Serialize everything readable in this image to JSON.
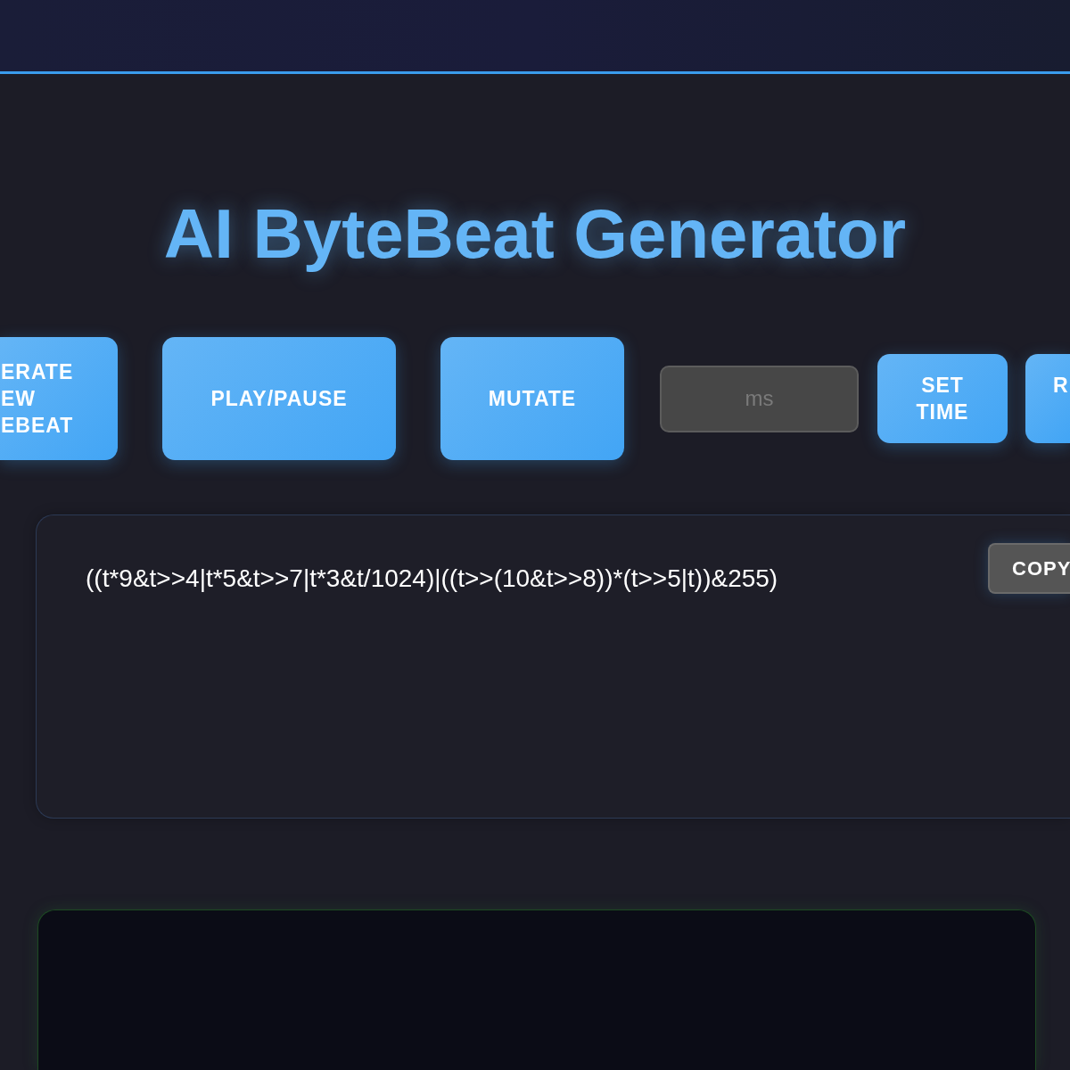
{
  "title": "AI ByteBeat Generator",
  "controls": [
    {
      "kind": "large-button",
      "lines": [
        "ERATE",
        "EW",
        "EBEAT"
      ]
    },
    {
      "kind": "large-button",
      "lines": [
        "PLAY/PAUSE"
      ]
    },
    {
      "kind": "large-button",
      "lines": [
        "MUTATE"
      ]
    },
    {
      "kind": "field",
      "placeholder": "ms"
    },
    {
      "kind": "small-button",
      "lines": [
        "SET",
        "TIME"
      ]
    },
    {
      "kind": "small-button",
      "lines": [
        "R"
      ]
    }
  ],
  "code_panel": {
    "expression": "((t*9&t>>4|t*5&t>>7|t*3&t/1024)|((t>>(10&t>>8))*(t>>5|t))&255)",
    "copy_label": "COPY"
  }
}
